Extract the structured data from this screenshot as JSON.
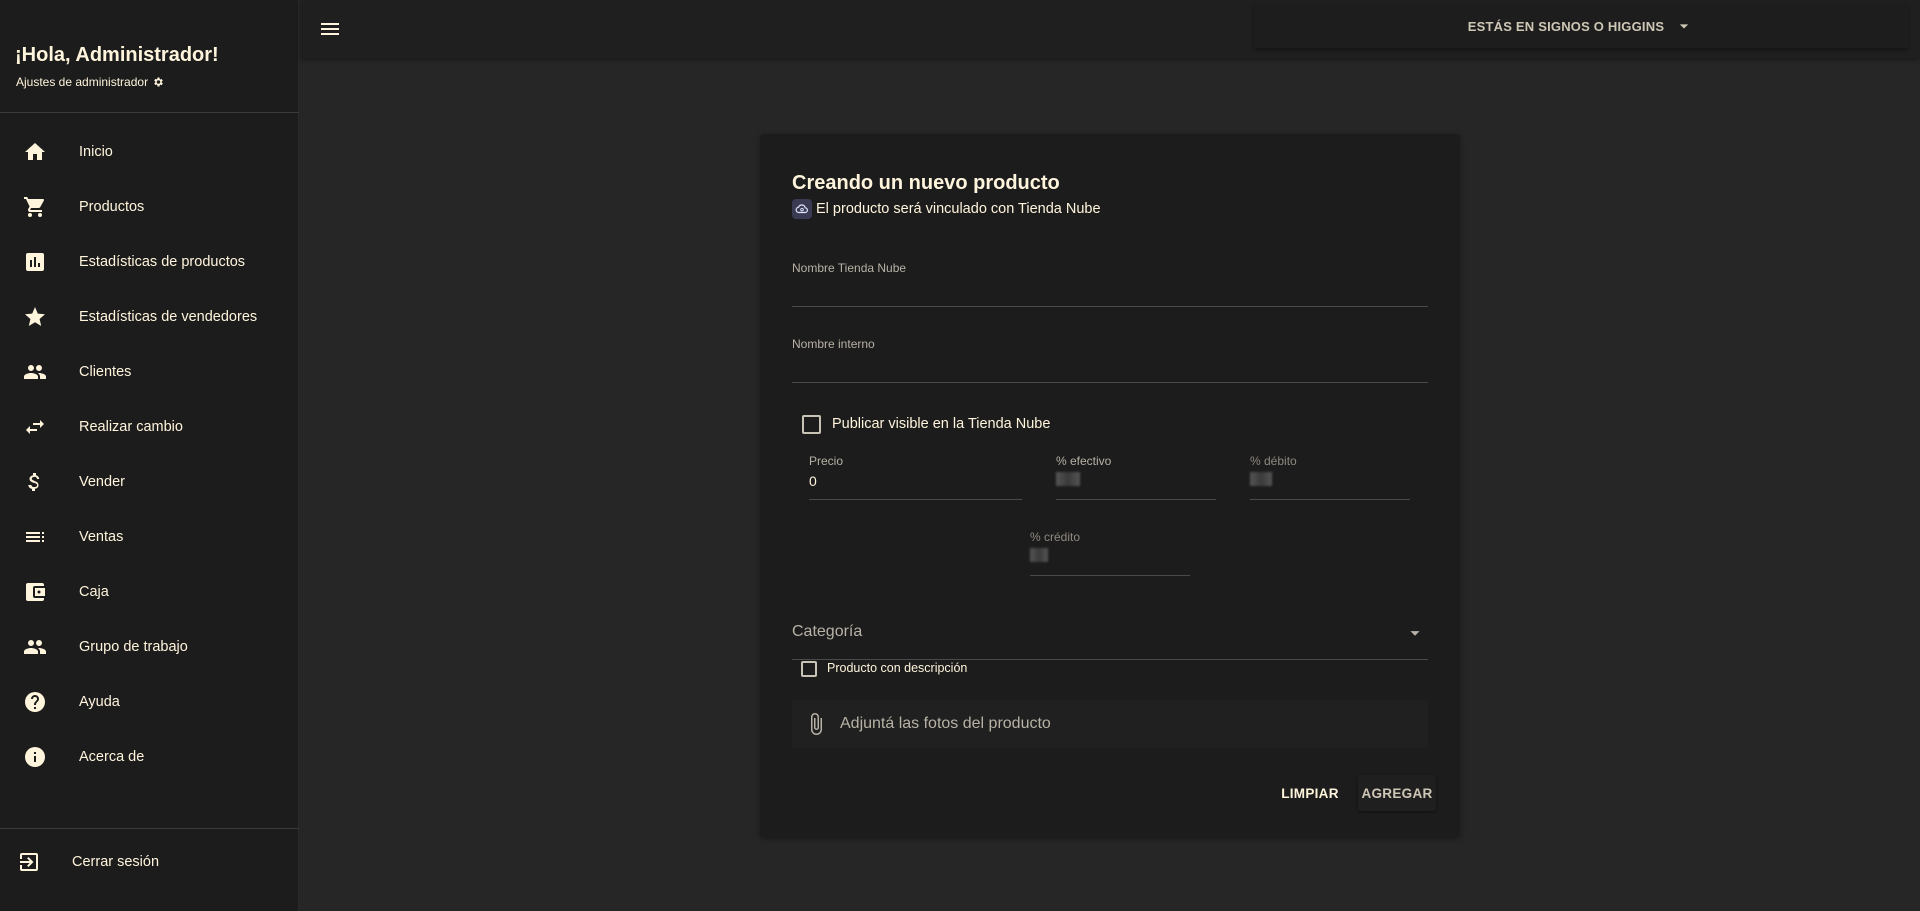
{
  "sidebar": {
    "greeting": "¡Hola, Administrador!",
    "admin_settings": "Ajustes de administrador",
    "items": [
      {
        "label": "Inicio",
        "icon": "home-icon"
      },
      {
        "label": "Productos",
        "icon": "cart-icon"
      },
      {
        "label": "Estadísticas de productos",
        "icon": "bar-chart-icon"
      },
      {
        "label": "Estadísticas de vendedores",
        "icon": "star-icon"
      },
      {
        "label": "Clientes",
        "icon": "people-icon"
      },
      {
        "label": "Realizar cambio",
        "icon": "swap-icon"
      },
      {
        "label": "Vender",
        "icon": "dollar-icon"
      },
      {
        "label": "Ventas",
        "icon": "list-icon"
      },
      {
        "label": "Caja",
        "icon": "wallet-icon"
      },
      {
        "label": "Grupo de trabajo",
        "icon": "group-icon"
      },
      {
        "label": "Ayuda",
        "icon": "help-icon"
      },
      {
        "label": "Acerca de",
        "icon": "info-icon"
      }
    ],
    "logout": "Cerrar sesión"
  },
  "topbar": {
    "branch_label": "ESTÁS EN SIGNOS O HIGGINS"
  },
  "form": {
    "title": "Creando un nuevo producto",
    "linked_text": "El producto será vinculado con Tienda Nube",
    "nombre_tienda_label": "Nombre Tienda Nube",
    "nombre_tienda_value": "",
    "nombre_interno_label": "Nombre interno",
    "nombre_interno_value": "",
    "publicar_label": "Publicar visible en la Tienda Nube",
    "publicar_checked": false,
    "precio_label": "Precio",
    "precio_value": "0",
    "efectivo_label": "% efectivo",
    "debito_label": "% débito",
    "credito_label": "% crédito",
    "categoria_label": "Categoría",
    "descripcion_label": "Producto con descripción",
    "descripcion_checked": false,
    "attach_label": "Adjuntá las fotos del producto",
    "limpiar_label": "LIMPIAR",
    "agregar_label": "AGREGAR"
  },
  "colors": {
    "text": "#fff4dc",
    "sidebar_bg": "#1c1c1c",
    "page_bg": "#262626"
  }
}
